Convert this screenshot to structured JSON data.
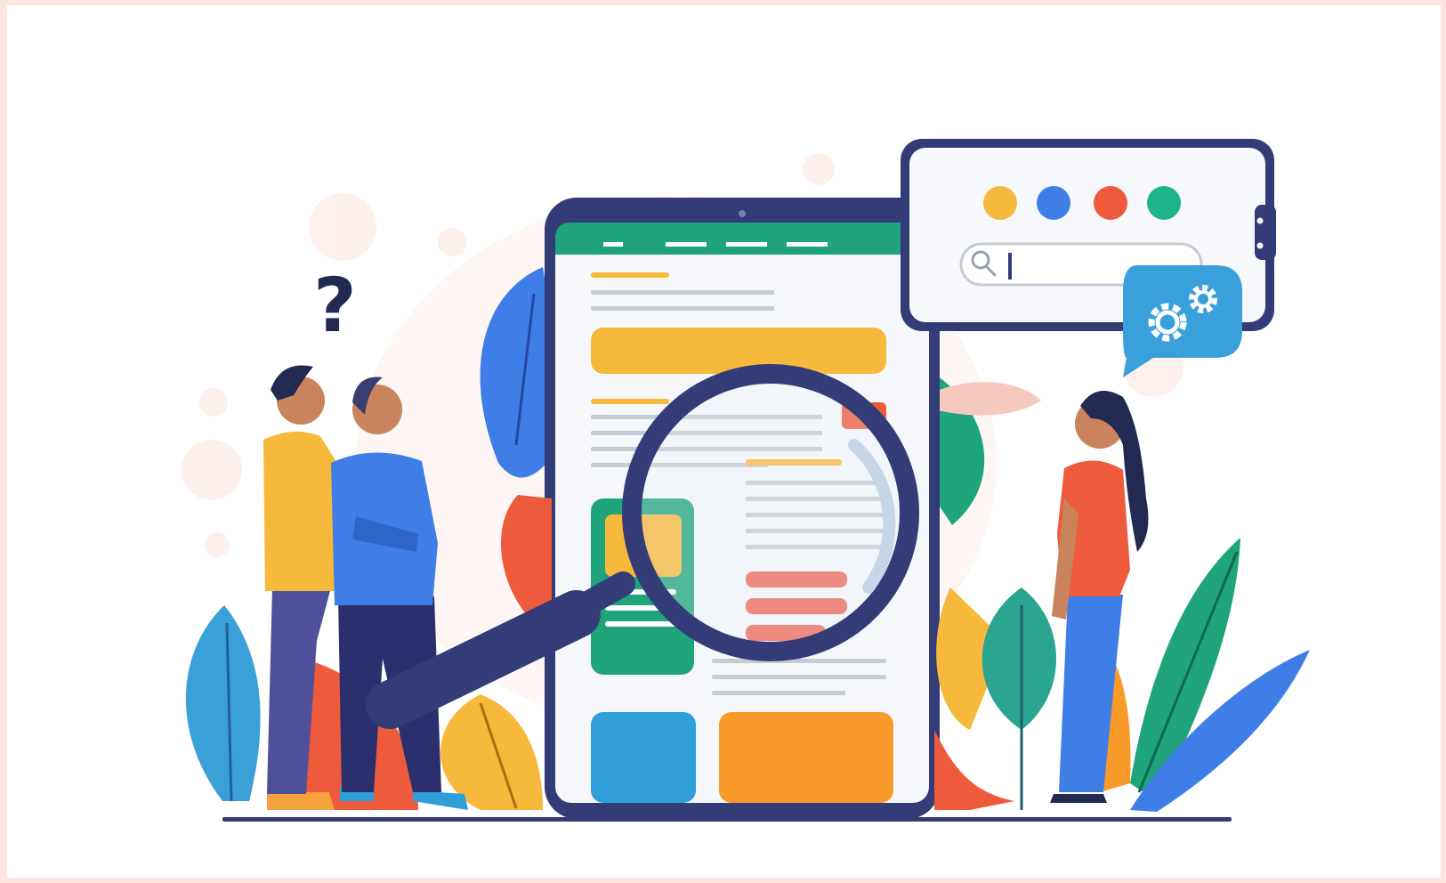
{
  "illustration": {
    "question_mark": "?",
    "search_value": "",
    "colors": {
      "page_border": "#fde6e2",
      "navy": "#343c78",
      "green_header": "#1fa47c",
      "yellow": "#f6b93b",
      "orange": "#f89a2a",
      "red": "#ee5a3c",
      "blue": "#3e7ee6",
      "sky": "#2f9ed9",
      "teal": "#1db48b",
      "bubble_blue": "#3aa0db"
    },
    "browser_dots": [
      "yellow",
      "blue",
      "red",
      "green"
    ],
    "icons": [
      "magnifier-icon",
      "search-icon",
      "gear-icon",
      "question-mark-icon"
    ]
  }
}
